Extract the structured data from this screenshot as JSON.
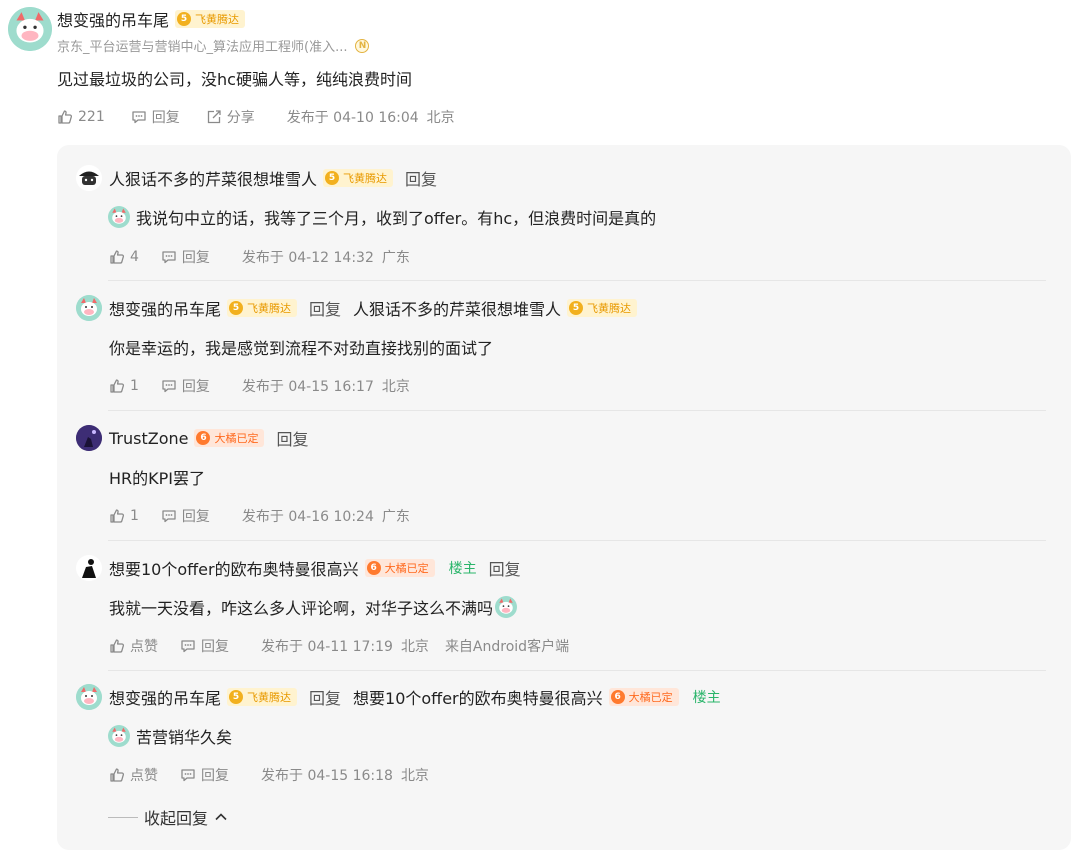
{
  "main": {
    "author": "想变强的吊车尾",
    "badge": {
      "level": "5",
      "text": "飞黄腾达"
    },
    "subtitle": "京东_平台运营与营销中心_算法应用工程师(准入...",
    "subtitle_badge": "N",
    "content": "见过最垃圾的公司，没hc硬骗人等，纯纯浪费时间",
    "likes": "221",
    "reply_label": "回复",
    "share_label": "分享",
    "posted": "发布于 04-10 16:04",
    "location": "北京"
  },
  "replies": [
    {
      "author": "人狠话不多的芹菜很想堆雪人",
      "badge": {
        "level": "5",
        "text": "飞黄腾达"
      },
      "reply_label": "回复",
      "content": "我说句中立的话，我等了三个月，收到了offer。有hc，但浪费时间是真的",
      "likes": "4",
      "action_reply": "回复",
      "posted": "发布于 04-12 14:32",
      "location": "广东"
    },
    {
      "author": "想变强的吊车尾",
      "badge": {
        "level": "5",
        "text": "飞黄腾达"
      },
      "reply_label": "回复",
      "target": "人狠话不多的芹菜很想堆雪人",
      "target_badge": {
        "level": "5",
        "text": "飞黄腾达"
      },
      "content": "你是幸运的，我是感觉到流程不对劲直接找别的面试了",
      "likes": "1",
      "action_reply": "回复",
      "posted": "发布于 04-15 16:17",
      "location": "北京"
    },
    {
      "author": "TrustZone",
      "badge": {
        "level": "6",
        "text": "大橘已定"
      },
      "reply_label": "回复",
      "content": "HR的KPI罢了",
      "likes": "1",
      "action_reply": "回复",
      "posted": "发布于 04-16 10:24",
      "location": "广东"
    },
    {
      "author": "想要10个offer的欧布奥特曼很高兴",
      "badge": {
        "level": "6",
        "text": "大橘已定"
      },
      "owner": "楼主",
      "reply_label": "回复",
      "content": "我就一天没看，咋这么多人评论啊，对华子这么不满吗",
      "likes": "点赞",
      "action_reply": "回复",
      "posted": "发布于 04-11 17:19",
      "location": "北京",
      "client": "来自Android客户端"
    },
    {
      "author": "想变强的吊车尾",
      "badge": {
        "level": "5",
        "text": "飞黄腾达"
      },
      "reply_label": "回复",
      "target": "想要10个offer的欧布奥特曼很高兴",
      "target_badge": {
        "level": "6",
        "text": "大橘已定"
      },
      "target_owner": "楼主",
      "content": "苦营销华久矣",
      "likes": "点赞",
      "action_reply": "回复",
      "posted": "发布于 04-15 16:18",
      "location": "北京"
    }
  ],
  "collapse_label": "收起回复",
  "colors": {
    "owner_green": "#2bb56b",
    "badge_gold": "#e89a00",
    "badge_orange": "#ff6a1f",
    "panel_bg": "#f6f6f6"
  }
}
